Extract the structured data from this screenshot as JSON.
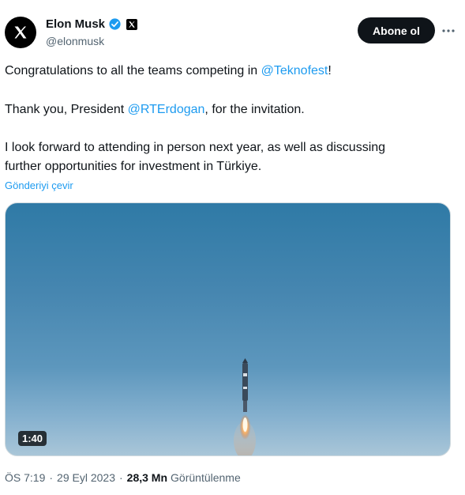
{
  "author": {
    "name": "Elon Musk",
    "handle": "@elonmusk"
  },
  "header": {
    "follow_label": "Abone ol"
  },
  "tweet": {
    "line1_pre": "Congratulations to all the teams competing in ",
    "line1_mention": "@Teknofest",
    "line1_post": "!",
    "line2_pre": "Thank you, President ",
    "line2_mention": "@RTErdogan",
    "line2_post": ", for the invitation.",
    "line3_a": "I look forward to attending in person next year, as well as discussing",
    "line3_b": "further opportunities for investment in Türkiye.",
    "translate_label": "Gönderiyi çevir"
  },
  "media": {
    "duration": "1:40"
  },
  "meta": {
    "time": "ÖS 7:19",
    "separator": "·",
    "date": "29 Eyl 2023",
    "views_count": "28,3 Mn",
    "views_label": "Görüntülenme"
  },
  "colors": {
    "link": "#1d9bf0",
    "text": "#0f1419",
    "muted": "#536471",
    "verified": "#1d9bf0"
  },
  "icons": {
    "avatar": "x-logo-icon",
    "verified": "verified-badge-icon",
    "affiliation": "x-affiliation-icon",
    "more": "more-horizontal-icon"
  }
}
